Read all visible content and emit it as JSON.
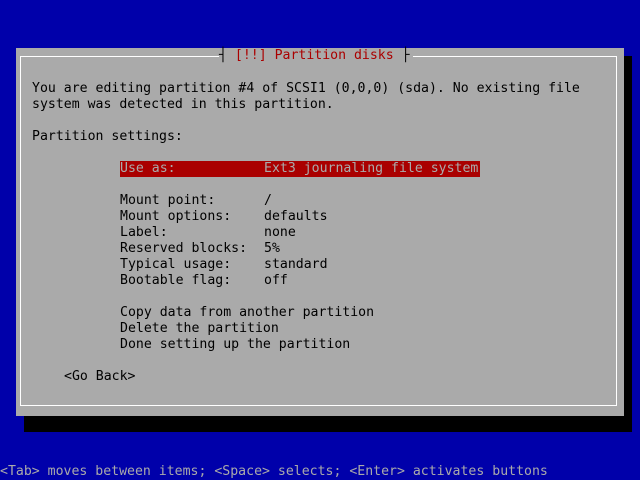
{
  "dialog": {
    "title": "[!!] Partition disks",
    "intro_line1": "You are editing partition #4 of SCSI1 (0,0,0) (sda). No existing file",
    "intro_line2": "system was detected in this partition.",
    "settings_header": "Partition settings:"
  },
  "settings": [
    {
      "label": "Use as:",
      "value": "Ext3 journaling file system",
      "selected": true
    },
    {
      "label": "Mount point:",
      "value": "/"
    },
    {
      "label": "Mount options:",
      "value": "defaults"
    },
    {
      "label": "Label:",
      "value": "none"
    },
    {
      "label": "Reserved blocks:",
      "value": "5%"
    },
    {
      "label": "Typical usage:",
      "value": "standard"
    },
    {
      "label": "Bootable flag:",
      "value": "off"
    }
  ],
  "actions": [
    {
      "label": "Copy data from another partition"
    },
    {
      "label": "Delete the partition"
    },
    {
      "label": "Done setting up the partition"
    }
  ],
  "buttons": {
    "go_back": "<Go Back>"
  },
  "footer": {
    "help": "<Tab> moves between items; <Space> selects; <Enter> activates buttons"
  },
  "colors": {
    "background": "#0000aa",
    "dialog": "#aaaaaa",
    "highlight": "#aa0000",
    "title_text": "#aa0000",
    "footer_text": "#aaaaaa"
  }
}
